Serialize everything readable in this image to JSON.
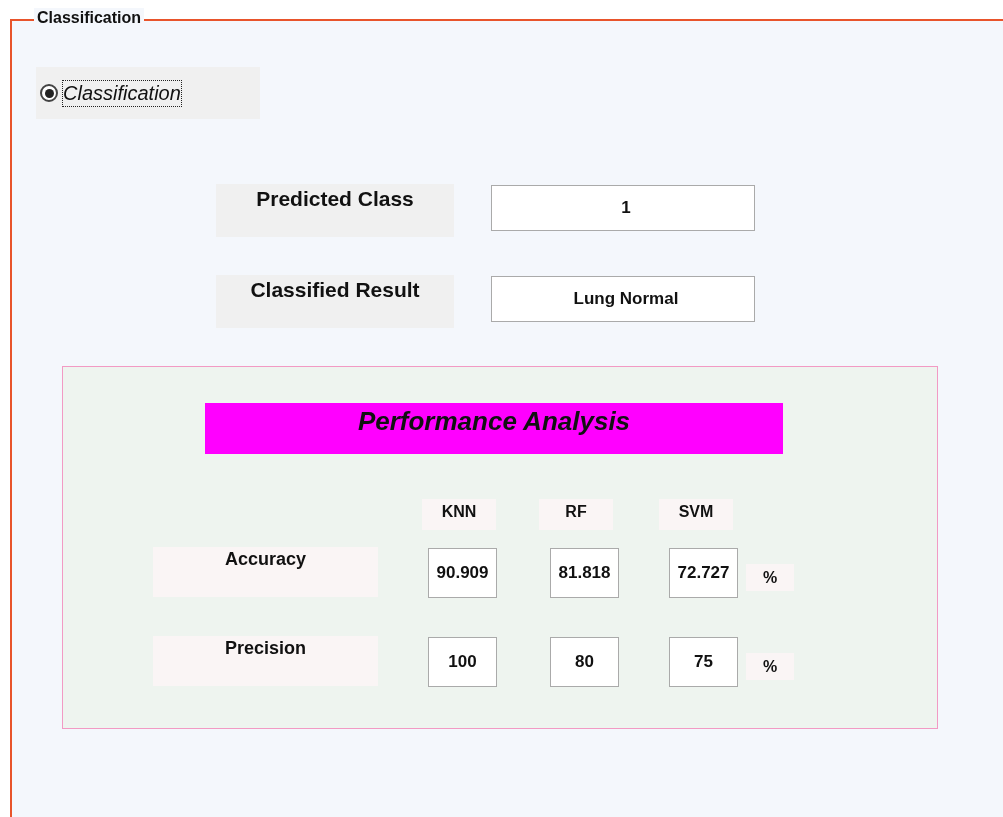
{
  "panel": {
    "title": "Classification"
  },
  "mode_radio": {
    "label": "Classification",
    "selected": true,
    "focused": true
  },
  "outputs": [
    {
      "label": "Predicted Class",
      "value": "1"
    },
    {
      "label": "Classified Result",
      "value": "Lung Normal"
    }
  ],
  "performance": {
    "title": "Performance Analysis",
    "columns": [
      "KNN",
      "RF",
      "SVM"
    ],
    "rows": [
      {
        "label": "Accuracy",
        "values": [
          "90.909",
          "81.818",
          "72.727"
        ],
        "unit": "%"
      },
      {
        "label": "Precision",
        "values": [
          "100",
          "80",
          "75"
        ],
        "unit": "%"
      }
    ]
  }
}
